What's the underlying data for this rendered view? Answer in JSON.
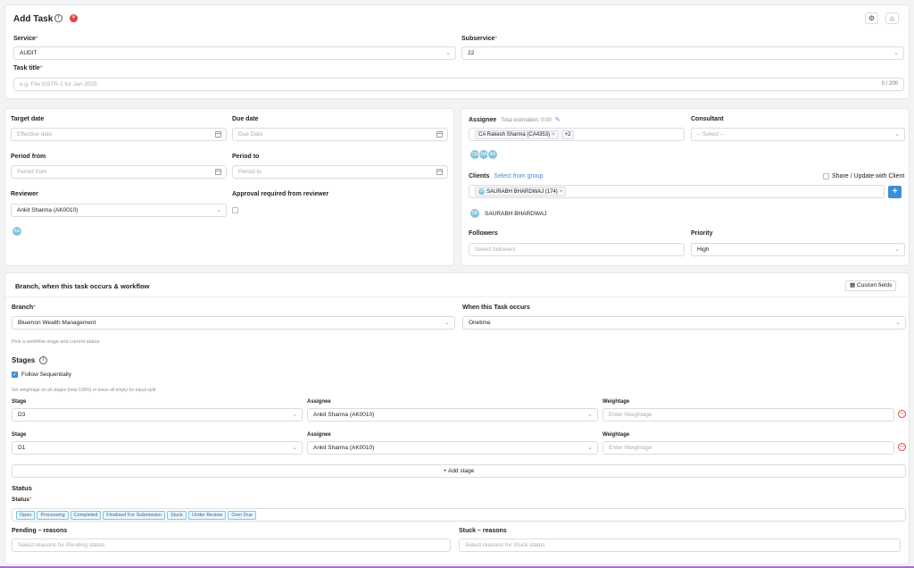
{
  "header": {
    "title": "Add Task"
  },
  "service": {
    "label": "Service",
    "value": "AUDIT"
  },
  "subservice": {
    "label": "Subservice",
    "value": "22"
  },
  "task_title": {
    "label": "Task title",
    "placeholder": "e.g. File GSTR-1 for Jan 2025",
    "counter": "0 / 200"
  },
  "dates": {
    "target_label": "Target date",
    "target_ph": "Effective date",
    "due_label": "Due date",
    "due_ph": "Due Date",
    "pfrom_label": "Period from",
    "pfrom_ph": "Period from",
    "pto_label": "Period to",
    "pto_ph": "Period to"
  },
  "reviewer": {
    "label": "Reviewer",
    "value": "Ankit Sharma (AK0010)",
    "avatar": "AS",
    "approval_label": "Approval required from reviewer"
  },
  "assignee": {
    "label": "Assignee",
    "estimation": "Total estimation: 0:00",
    "chip": "CA Rakesh Sharma (CA4353)",
    "more": "+2",
    "avatars": [
      "CR",
      "DA",
      "AS"
    ]
  },
  "consultant": {
    "label": "Consultant",
    "placeholder": "-- Select --"
  },
  "clients": {
    "label": "Clients",
    "select_group": "Select from group",
    "share_label": "Share / Update with Client",
    "chip": "SAURABH BHARDWAJ (174)",
    "chip_avatar": "SB",
    "client_name": "SAURABH BHARDWAJ",
    "client_avatar": "SB",
    "add": "+"
  },
  "followers": {
    "label": "Followers",
    "placeholder": "Select followers"
  },
  "priority": {
    "label": "Priority",
    "value": "High"
  },
  "section": {
    "title": "Branch, when this task occurs & workflow",
    "custom_fields": "Custom fields"
  },
  "branch": {
    "label": "Branch",
    "value": "Bluemon Wealth Management"
  },
  "occurs": {
    "label": "When this Task occurs",
    "value": "Onetime"
  },
  "workflow_hint": "Pick a workflow stage and current status.",
  "stages": {
    "title": "Stages",
    "follow_label": "Follow Sequentially",
    "weight_hint": "Set weightage on all stages (total 100%) or leave all empty for equal split",
    "rows": [
      {
        "stage_label": "Stage",
        "stage": "D3",
        "assignee_label": "Assignee",
        "assignee": "Ankit Sharma (AK0010)",
        "weight_label": "Weightage",
        "weight_ph": "Enter Weightage"
      },
      {
        "stage_label": "Stage",
        "stage": "D1",
        "assignee_label": "Assignee",
        "assignee": "Ankit Sharma (AK0010)",
        "weight_label": "Weightage",
        "weight_ph": "Enter Weightage"
      }
    ],
    "add_stage": "+ Add stage"
  },
  "status": {
    "title": "Status",
    "label": "Status",
    "tags": [
      "Open",
      "Processing",
      "Completed",
      "Finalised For Submission",
      "Stuck",
      "Under Review",
      "Over Due"
    ]
  },
  "pending": {
    "label": "Pending – reasons",
    "placeholder": "Select reasons for Pending status"
  },
  "stuck": {
    "label": "Stuck – reasons",
    "placeholder": "Select reasons for Stuck status"
  }
}
